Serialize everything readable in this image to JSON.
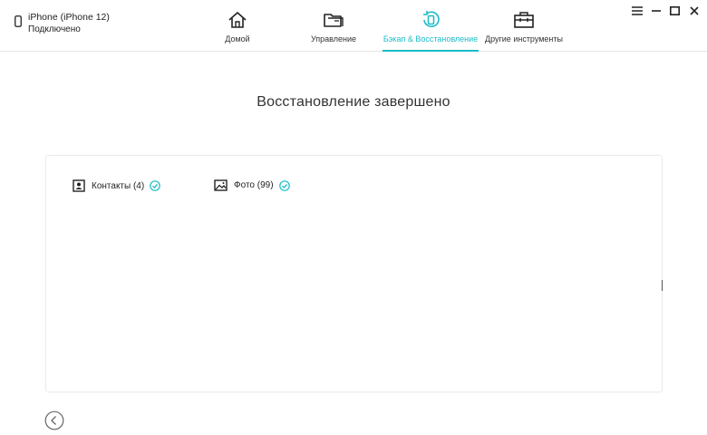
{
  "device": {
    "name": "iPhone (iPhone 12)",
    "status": "Подключено",
    "icon": "phone-icon"
  },
  "nav": {
    "tabs": [
      {
        "label": "Домой",
        "icon": "home-icon",
        "active": false
      },
      {
        "label": "Управление",
        "icon": "folder-icon",
        "active": false
      },
      {
        "label": "Бэкап & Восстановление",
        "icon": "backup-restore-icon",
        "active": true
      },
      {
        "label": "Другие инструменты",
        "icon": "toolbox-icon",
        "active": false
      }
    ]
  },
  "window_controls": {
    "menu": "menu-icon",
    "minimize": "minimize-icon",
    "maximize": "maximize-icon",
    "close": "close-icon"
  },
  "main": {
    "title": "Восстановление завершено",
    "results": [
      {
        "label": "Контакты (4)",
        "icon": "contacts-icon",
        "status": "check-circle-icon"
      },
      {
        "label": "Фото (99)",
        "icon": "photo-icon",
        "status": "check-circle-icon"
      }
    ]
  },
  "footer": {
    "back": "back-arrow-icon"
  },
  "colors": {
    "accent": "#1bbcc9",
    "text": "#222222",
    "border": "#e6e6e6"
  }
}
